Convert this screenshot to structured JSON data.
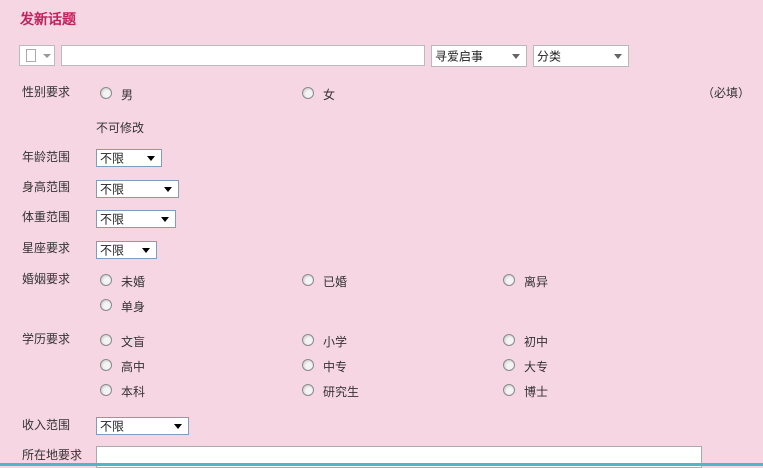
{
  "header": {
    "title": "发新话题"
  },
  "topbar": {
    "subject_value": "",
    "type_select": "寻爱启事",
    "category_select": "分类"
  },
  "gender": {
    "label": "性别要求",
    "options": [
      "男",
      "女"
    ],
    "required_note": "（必填）",
    "note": "不可修改"
  },
  "age": {
    "label": "年龄范围",
    "value": "不限"
  },
  "height": {
    "label": "身高范围",
    "value": "不限"
  },
  "weight": {
    "label": "体重范围",
    "value": "不限"
  },
  "zodiac": {
    "label": "星座要求",
    "value": "不限"
  },
  "marriage": {
    "label": "婚姻要求",
    "options": [
      "未婚",
      "已婚",
      "离异",
      "单身"
    ]
  },
  "education": {
    "label": "学历要求",
    "options": [
      "文盲",
      "小学",
      "初中",
      "高中",
      "中专",
      "大专",
      "本科",
      "研究生",
      "博士"
    ]
  },
  "income": {
    "label": "收入范围",
    "value": "不限"
  },
  "location": {
    "label": "所在地要求",
    "value": ""
  }
}
